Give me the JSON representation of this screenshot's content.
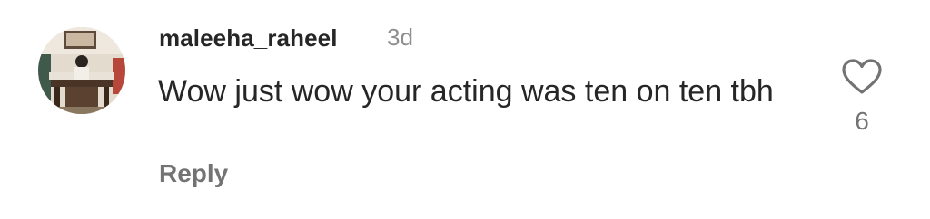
{
  "comment": {
    "username": "maleeha_raheel",
    "timestamp": "3d",
    "text": "Wow just wow your acting was ten on ten tbh",
    "reply_label": "Reply",
    "like_count": "6",
    "like_icon": "heart-outline-icon"
  },
  "colors": {
    "text_primary": "#262626",
    "text_secondary": "#8e8e8e",
    "reply": "#737373"
  }
}
